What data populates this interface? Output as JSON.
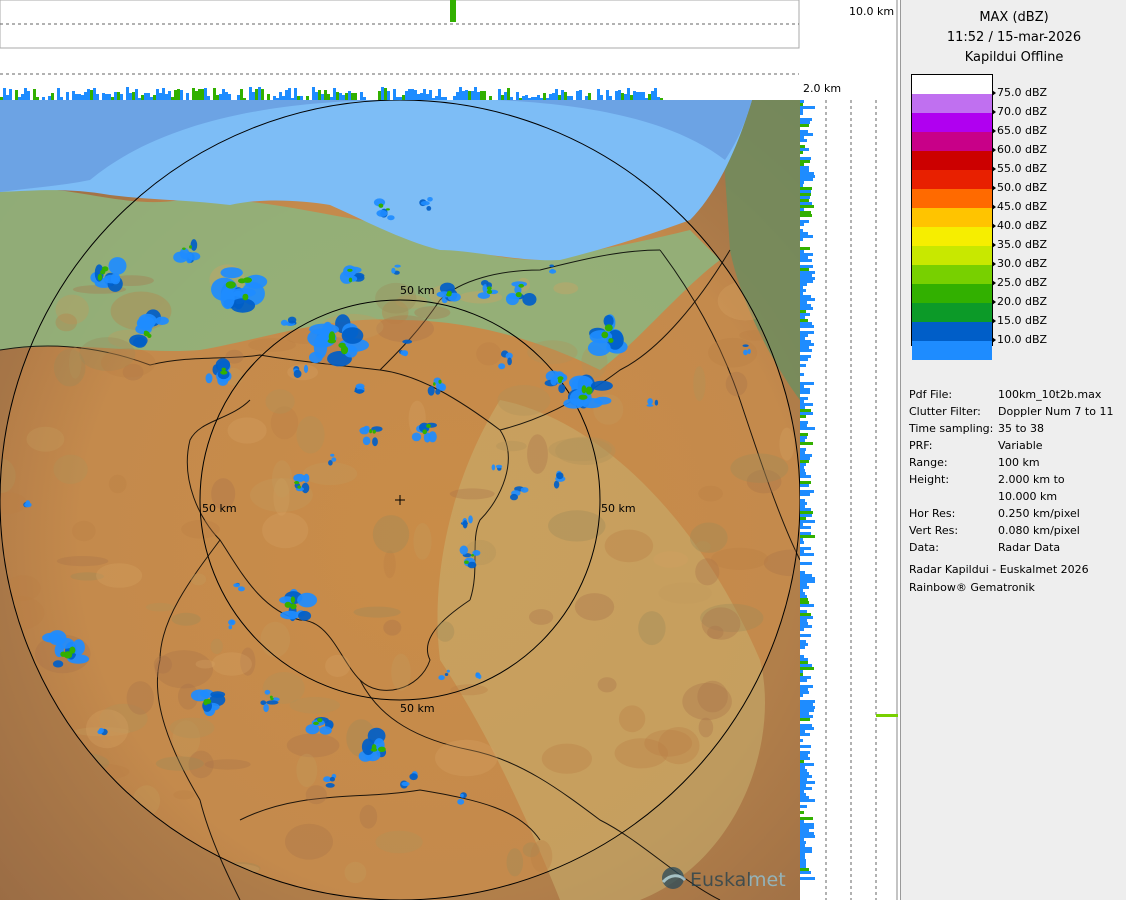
{
  "product": {
    "title": "MAX (dBZ)",
    "datetime": "11:52 / 15-mar-2026",
    "status": "Kapildui Offline"
  },
  "legend": {
    "entries": [
      {
        "label": "75.0 dBZ",
        "color": "#c070f0"
      },
      {
        "label": "70.0 dBZ",
        "color": "#b000f0"
      },
      {
        "label": "65.0 dBZ",
        "color": "#c80088"
      },
      {
        "label": "60.0 dBZ",
        "color": "#cc0000"
      },
      {
        "label": "55.0 dBZ",
        "color": "#e82000"
      },
      {
        "label": "50.0 dBZ",
        "color": "#ff6a00"
      },
      {
        "label": "45.0 dBZ",
        "color": "#ffc400"
      },
      {
        "label": "40.0 dBZ",
        "color": "#f6ee00"
      },
      {
        "label": "35.0 dBZ",
        "color": "#c8e800"
      },
      {
        "label": "30.0 dBZ",
        "color": "#78d000"
      },
      {
        "label": "25.0 dBZ",
        "color": "#32b000"
      },
      {
        "label": "20.0 dBZ",
        "color": "#0c9a28"
      },
      {
        "label": "15.0 dBZ",
        "color": "#005ec8"
      },
      {
        "label": "10.0 dBZ",
        "color": "#1e8cff"
      }
    ],
    "top_color": "#ffffff"
  },
  "metadata": [
    {
      "key": "Pdf File:",
      "value": "100km_10t2b.max"
    },
    {
      "key": "Clutter Filter:",
      "value": "Doppler Num 7 to 11"
    },
    {
      "key": "Time sampling:",
      "value": "35 to 38"
    },
    {
      "key": "PRF:",
      "value": "Variable"
    },
    {
      "key": "Range:",
      "value": "100 km"
    },
    {
      "key": "Height:",
      "value": "2.000 km to"
    },
    {
      "key": "",
      "value": "10.000 km"
    },
    {
      "key": "Hor Res:",
      "value": "0.250 km/pixel"
    },
    {
      "key": "Vert Res:",
      "value": "0.080 km/pixel"
    },
    {
      "key": "Data:",
      "value": "Radar Data"
    }
  ],
  "credits": {
    "line1": "Radar Kapildui - Euskalmet 2026",
    "line2": "Rainbow® Gematronik"
  },
  "map": {
    "range_ring_label": "50 km",
    "height_top_label": "10.0 km",
    "height_bottom_label": "2.0 km",
    "brand_text_1": "Euskal",
    "brand_text_2": "met",
    "colors": {
      "sea": "#7dbdf6",
      "sea_far": "#6aa0e2",
      "land_green": "#8fb37c",
      "land_orange": "#c98c48",
      "land_dark": "#9c6a42",
      "echo_light": "#1e8cff",
      "echo_mid": "#005ec8",
      "echo_green": "#32b000"
    }
  }
}
